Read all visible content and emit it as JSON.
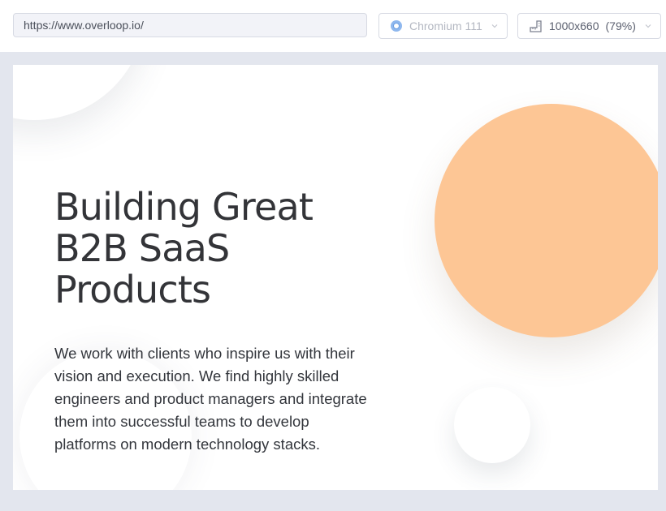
{
  "toolbar": {
    "url": "https://www.overloop.io/",
    "browser": {
      "label": "Chromium 111",
      "icon": "chromium-icon"
    },
    "viewport": {
      "resolution": "1000x660",
      "zoom": "(79%)",
      "icon": "ruler-icon"
    }
  },
  "page": {
    "hero": {
      "title": "Building Great B2B SaaS Products",
      "description": "We work with clients who inspire us with their vision and execution. We find highly skilled engineers and product managers and integrate them into successful teams to develop platforms on modern technology stacks."
    }
  },
  "colors": {
    "accent_circle": "#fdc695",
    "frame_background": "#e3e6ee",
    "title_text": "#333438"
  }
}
